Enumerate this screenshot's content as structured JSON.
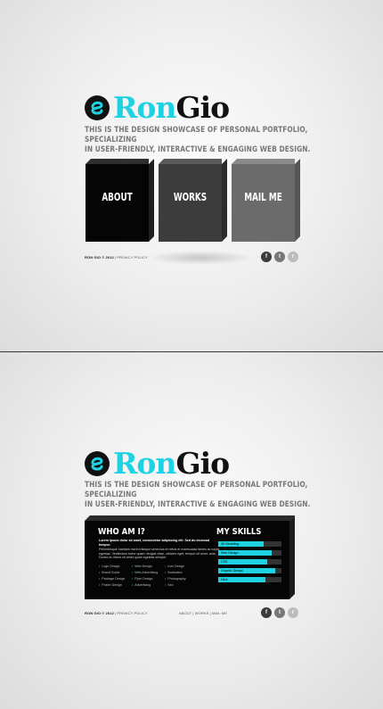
{
  "brand": {
    "name_part1": "Ron",
    "name_part2": "Gio",
    "tagline_line1": "THIS IS THE DESIGN SHOWCASE OF PERSONAL PORTFOLIO, SPECIALIZING",
    "tagline_line2": "IN USER-FRIENDLY, INTERACTIVE & ENGAGING WEB DESIGN.",
    "accent_color": "#1ed2e2"
  },
  "nav": {
    "about": "ABOUT",
    "works": "WORKS",
    "mail": "MAIL ME"
  },
  "footer": {
    "copyright": "RON GIO © 2012",
    "separator": "|",
    "privacy": "PRIVACY POLICY",
    "nav_about": "ABOUT",
    "nav_works": "WORKS",
    "nav_mail": "MAIL ME"
  },
  "social": {
    "facebook": "f",
    "twitter": "t",
    "rss": "r"
  },
  "about_panel": {
    "heading": "WHO AM I?",
    "lead": "Lorem ipsum dolor sit amet, consectetur adipiscing elit. Sed do eiusmod tempor.",
    "body": "Pellentesque habitant morbi tristique senectus et netus et malesuada fames ac turpis egestas. Vestibulum tortor quam, feugiat vitae, ultricies eget, tempor sit amet, ante. Donec eu libero sit amet quam egestas semper.",
    "services_col1": [
      "Logo Design",
      "Brand Guide",
      "Package Design",
      "Poster Design"
    ],
    "services_col2": [
      "Web Design",
      "Web Advertising",
      "Flyer Design",
      "Advertising"
    ],
    "services_col3": [
      "Icon Design",
      "Illustration",
      "Photography",
      "Seo"
    ]
  },
  "skills_panel": {
    "heading": "MY SKILLS",
    "skills": [
      {
        "name": "3D Modeling",
        "level": 0.72
      },
      {
        "name": "Web Design",
        "level": 0.85
      },
      {
        "name": "CSS",
        "level": 0.78
      },
      {
        "name": "Graphic Design",
        "level": 0.9
      },
      {
        "name": "Html",
        "level": 0.75
      }
    ]
  }
}
